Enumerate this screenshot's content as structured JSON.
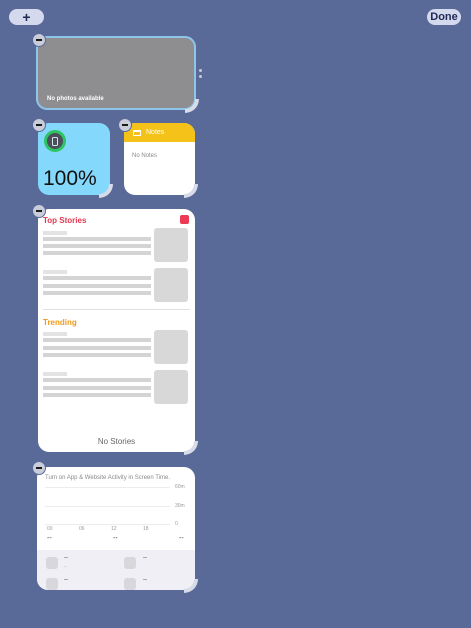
{
  "toolbar": {
    "add_label": "+",
    "done_label": "Done"
  },
  "photos": {
    "label": "No photos available"
  },
  "battery": {
    "percent": "100%"
  },
  "notes": {
    "title": "Notes",
    "empty_text": "No Notes"
  },
  "news": {
    "top_title": "Top Stories",
    "trending_title": "Trending",
    "empty_text": "No Stories"
  },
  "screentime": {
    "message": "Turn on App & Website Activity in Screen Time.",
    "y_labels": [
      "60m",
      "30m",
      "0"
    ],
    "x_labels": [
      "00",
      "06",
      "12",
      "18"
    ],
    "summary": [
      "--",
      "--",
      "--"
    ],
    "apps": [
      {
        "value": "--",
        "sub": "--"
      },
      {
        "value": "--"
      },
      {
        "value": "--"
      },
      {
        "value": "--"
      }
    ]
  },
  "colors": {
    "background": "#5a6a98",
    "battery": "#84d8fb",
    "notes_header": "#f5c219",
    "news_top": "#e8364f",
    "news_trending": "#f09a1a"
  }
}
